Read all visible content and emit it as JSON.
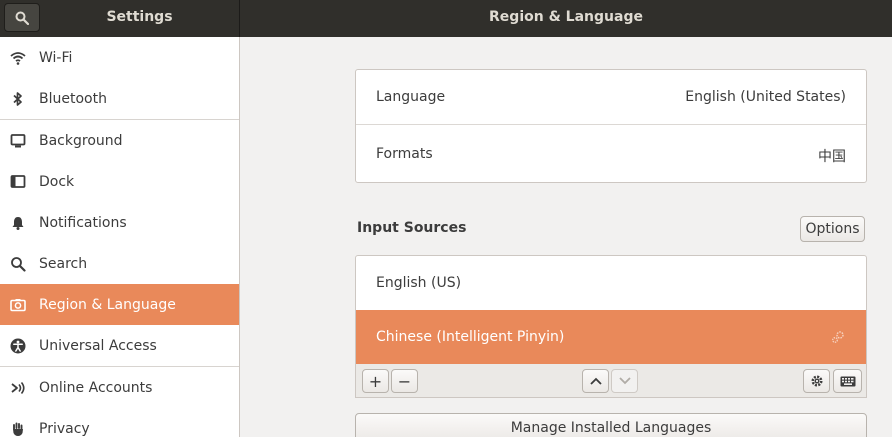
{
  "header": {
    "left_title": "Settings",
    "main_title": "Region & Language"
  },
  "sidebar": {
    "items": [
      {
        "label": "Wi-Fi",
        "icon": "wifi-icon"
      },
      {
        "label": "Bluetooth",
        "icon": "bluetooth-icon"
      },
      {
        "label": "Background",
        "icon": "monitor-icon"
      },
      {
        "label": "Dock",
        "icon": "dock-icon"
      },
      {
        "label": "Notifications",
        "icon": "bell-icon"
      },
      {
        "label": "Search",
        "icon": "search-icon"
      },
      {
        "label": "Region & Language",
        "icon": "camera-icon",
        "active": true
      },
      {
        "label": "Universal Access",
        "icon": "accessibility-icon"
      },
      {
        "label": "Online Accounts",
        "icon": "online-accounts-icon"
      },
      {
        "label": "Privacy",
        "icon": "hand-icon"
      }
    ]
  },
  "language": {
    "label": "Language",
    "value": "English (United States)"
  },
  "formats": {
    "label": "Formats",
    "value": "中国"
  },
  "input_sources": {
    "title": "Input Sources",
    "options_label": "Options",
    "items": [
      {
        "label": "English (US)"
      },
      {
        "label": "Chinese (Intelligent Pinyin)",
        "selected": true
      }
    ],
    "add_label": "+",
    "remove_label": "−"
  },
  "manage_label": "Manage Installed Languages",
  "colors": {
    "accent": "#e9895a",
    "header_bg": "#302f2b",
    "window_bg": "#f2f1f0"
  }
}
